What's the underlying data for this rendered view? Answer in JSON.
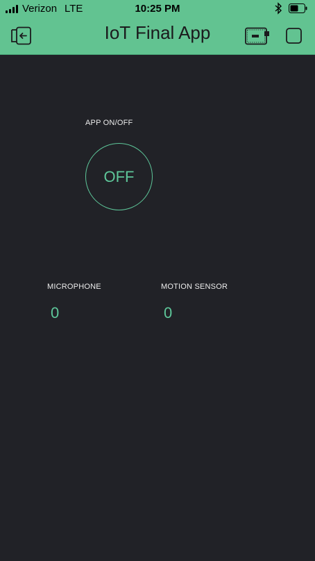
{
  "status_bar": {
    "carrier": "Verizon",
    "network": "LTE",
    "time": "10:25 PM",
    "icons": [
      "signal-bars-icon",
      "bluetooth-icon",
      "battery-icon"
    ]
  },
  "header": {
    "title": "IoT Final App",
    "icons": [
      "exit-icon",
      "device-icon",
      "square-icon"
    ],
    "background": "#62c391"
  },
  "widgets": {
    "app_toggle": {
      "label": "APP ON/OFF",
      "state": "OFF"
    },
    "microphone": {
      "label": "MICROPHONE",
      "value": "0"
    },
    "motion_sensor": {
      "label": "MOTION SENSOR",
      "value": "0"
    }
  },
  "colors": {
    "accent": "#5ec79a",
    "canvas": "#212227",
    "label_text": "#ececec"
  }
}
